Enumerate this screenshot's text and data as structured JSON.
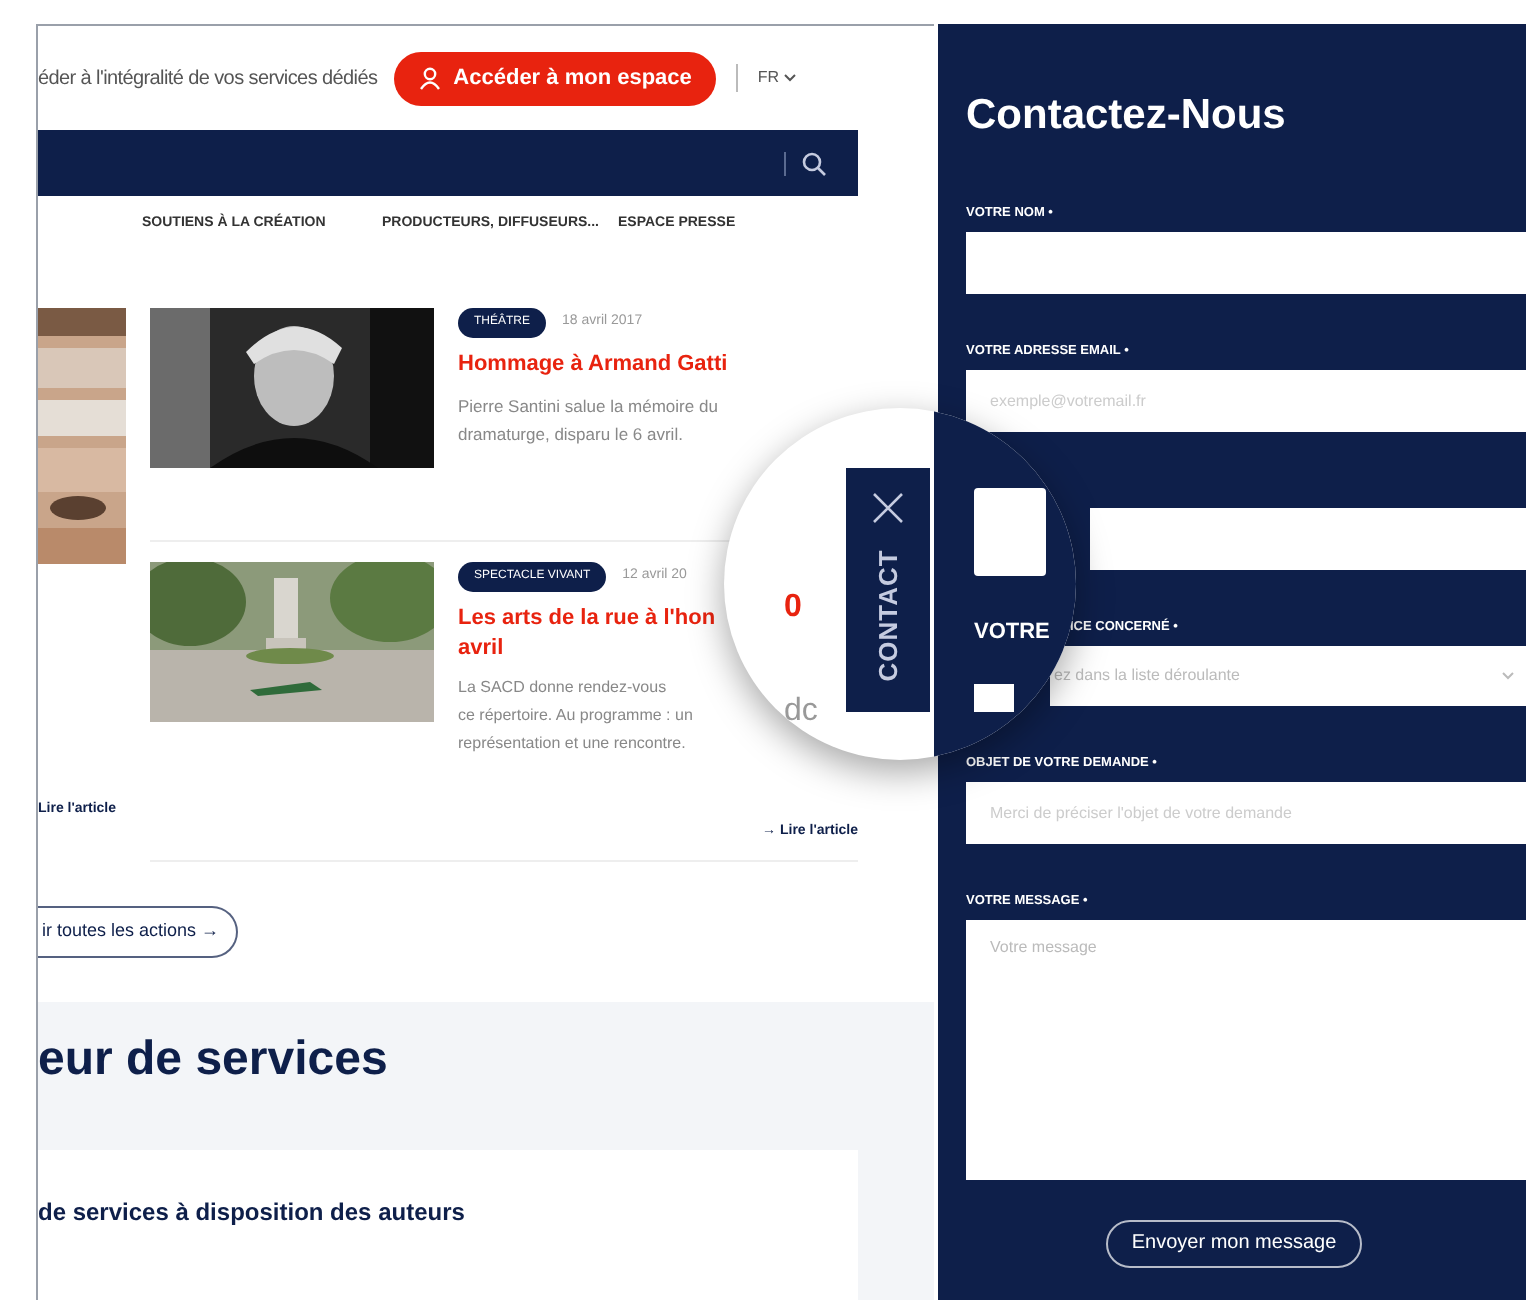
{
  "header": {
    "intro": "éder à l'intégralité de vos services dédiés",
    "account_button": "Accéder à mon espace",
    "language": "FR"
  },
  "menu": [
    {
      "label": "SOUTIENS À LA CRÉATION"
    },
    {
      "label": "PRODUCTEURS, DIFFUSEURS..."
    },
    {
      "label": "ESPACE PRESSE"
    }
  ],
  "side_article": {
    "link": "Lire l'article"
  },
  "articles": [
    {
      "tag": "THÉÂTRE",
      "date": "18 avril 2017",
      "title": "Hommage à Armand Gatti",
      "summary": "Pierre Santini salue la mémoire du dramaturge, disparu le 6 avril."
    },
    {
      "tag": "SPECTACLE VIVANT",
      "date": "12 avril 20",
      "title": "Les arts de la rue à l'hon",
      "title_end": "avril",
      "summary_lines": [
        "La SACD donne rendez-vous",
        "ce répertoire. Au programme : un",
        "représentation et une rencontre."
      ],
      "link": "→ Lire l'article"
    }
  ],
  "all_actions_button": "ir toutes les actions →",
  "services": {
    "heading": "eur de services",
    "card_title": "de services à disposition des auteurs"
  },
  "contact_form": {
    "title": "Contactez-Nous",
    "fields": [
      {
        "kind": "input",
        "label": "VOTRE NOM •"
      },
      {
        "kind": "input",
        "label": "VOTRE ADRESSE EMAIL •",
        "placeholder": "exemple@votremail.fr"
      },
      {
        "kind": "input"
      },
      {
        "kind": "select",
        "label": "ICE CONCERNÉ •",
        "placeholder": "ez dans la liste déroulante"
      },
      {
        "kind": "input",
        "label": "OBJET DE VOTRE DEMANDE •",
        "placeholder": "Merci de préciser l'objet de votre demande"
      },
      {
        "kind": "textarea",
        "label": "VOTRE MESSAGE •",
        "placeholder": "Votre message"
      }
    ],
    "submit": "Envoyer mon message"
  },
  "magnifier": {
    "tab": "CONTACT",
    "label": "VOTRE",
    "title_part": "0",
    "text_part": "dc"
  }
}
